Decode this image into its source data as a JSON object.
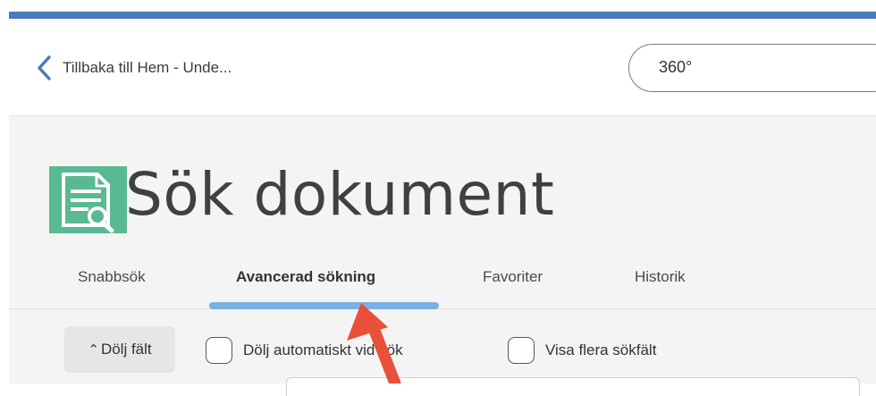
{
  "header": {
    "back_label": "Tillbaka till Hem - Unde...",
    "search_value": "360°"
  },
  "page": {
    "title": "Sök dokument",
    "icon": "search-document-icon"
  },
  "tabs": [
    {
      "label": "Snabbsök",
      "active": false
    },
    {
      "label": "Avancerad sökning",
      "active": true
    },
    {
      "label": "Favoriter",
      "active": false
    },
    {
      "label": "Historik",
      "active": false
    }
  ],
  "options": {
    "toggle_fields_label": "Dölj fält",
    "checkbox_auto_hide_label": "Dölj automatiskt vid sök",
    "checkbox_auto_hide_checked": false,
    "checkbox_multi_fields_label": "Visa flera sökfält",
    "checkbox_multi_fields_checked": false
  },
  "colors": {
    "top_bar": "#4a7bbd",
    "tab_indicator": "#7ab0e4",
    "icon_green": "#58b992",
    "annotation_arrow": "#e8503a"
  }
}
